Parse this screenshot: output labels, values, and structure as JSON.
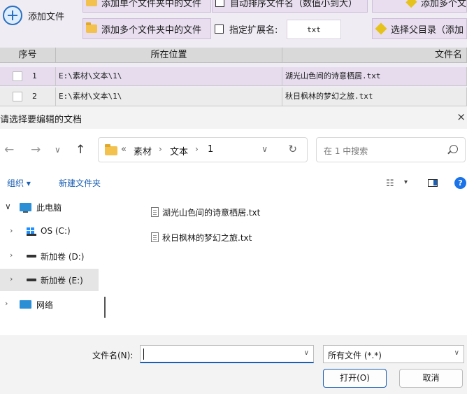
{
  "toolbar": {
    "add_file": "添加文件",
    "add_single_folder": "添加单个文件夹中的文件",
    "auto_sort": "自动排序文件名（数值小到大）",
    "add_multiple_right": "添加多个文",
    "add_multi_folder": "添加多个文件夹中的文件",
    "specify_ext_label": "指定扩展名:",
    "ext_value": "txt",
    "select_parent": "选择父目录（添加"
  },
  "grid": {
    "headers": [
      "序号",
      "所在位置",
      "文件名"
    ],
    "rows": [
      {
        "num": "1",
        "location": "E:\\素材\\文本\\1\\",
        "filename": "湖光山色间的诗意栖居.txt"
      },
      {
        "num": "2",
        "location": "E:\\素材\\文本\\1\\",
        "filename": "秋日枫林的梦幻之旅.txt"
      }
    ]
  },
  "dialog": {
    "title": "请选择要编辑的文档",
    "close": "×",
    "nav": {
      "back": "←",
      "forward": "→",
      "recent": "∨",
      "up": "↑"
    },
    "address": {
      "overflow": "«",
      "crumbs": [
        "素材",
        "文本",
        "1"
      ],
      "sep": "›",
      "dropdown": "∨",
      "refresh": "↻"
    },
    "search_placeholder": "在 1 中搜索",
    "cmd": {
      "organize": "组织 ▾",
      "new_folder": "新建文件夹",
      "view": "☷",
      "view_drop": "▾",
      "help": "?"
    },
    "tree": [
      {
        "label": "此电脑",
        "twisty": "∨"
      },
      {
        "label": "OS (C:)",
        "twisty": "›"
      },
      {
        "label": "新加卷 (D:)",
        "twisty": "›"
      },
      {
        "label": "新加卷 (E:)",
        "twisty": "›"
      },
      {
        "label": "网络",
        "twisty": "›"
      }
    ],
    "files": [
      "湖光山色间的诗意栖居.txt",
      "秋日枫林的梦幻之旅.txt"
    ],
    "filename_label": "文件名(N):",
    "filename_value": "",
    "filetype": "所有文件 (*.*)",
    "open_button": "打开(O)",
    "cancel_button": "取消"
  }
}
